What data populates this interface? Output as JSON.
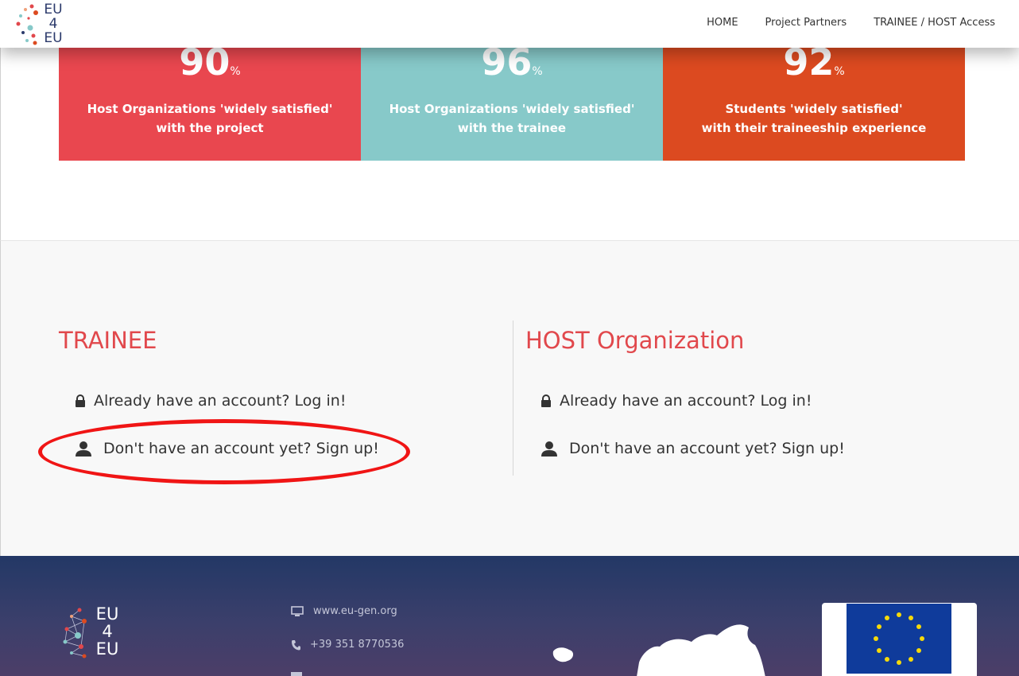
{
  "brand": {
    "line1": "EU",
    "line2": "4",
    "line3": "EU"
  },
  "nav": {
    "items": [
      {
        "label": "HOME"
      },
      {
        "label": "Project Partners"
      },
      {
        "label": "TRAINEE / HOST Access"
      }
    ]
  },
  "stats": [
    {
      "value": "90",
      "unit": "%",
      "line1": "Host Organizations 'widely satisfied'",
      "line2": "with the project",
      "color": "#e9474f"
    },
    {
      "value": "96",
      "unit": "%",
      "line1": "Host Organizations 'widely satisfied'",
      "line2": "with the trainee",
      "color": "#87c9c9"
    },
    {
      "value": "92",
      "unit": "%",
      "line1": "Students 'widely satisfied'",
      "line2": "with their traineeship experience",
      "color": "#dc4a20"
    }
  ],
  "access": {
    "trainee": {
      "title": "TRAINEE",
      "login": "Already have an account? Log in!",
      "signup": "Don't have an account yet? Sign up!"
    },
    "host": {
      "title": "HOST Organization",
      "login": "Already have an account? Log in!",
      "signup": "Don't have an account yet? Sign up!"
    },
    "accent_color": "#e1484c",
    "annotation_color": "#f01515"
  },
  "footer": {
    "website": "www.eu-gen.org",
    "phone": "+39 351 8770536",
    "icons": [
      "monitor-icon",
      "phone-icon"
    ]
  }
}
